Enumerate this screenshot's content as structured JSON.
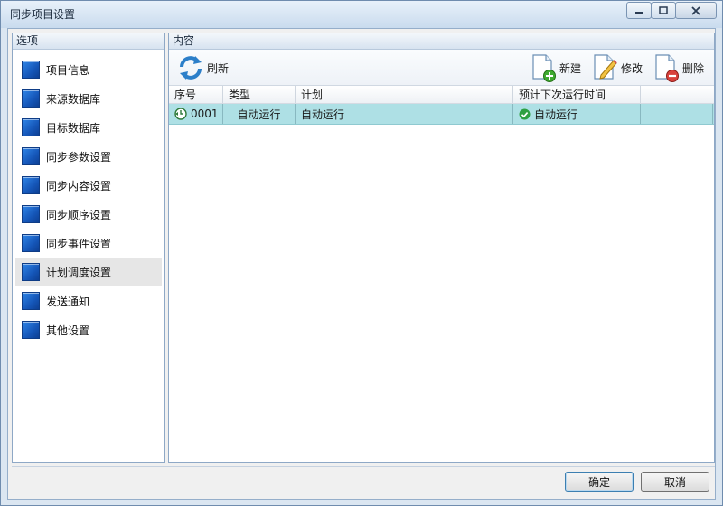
{
  "window": {
    "title": "同步项目设置",
    "controls": {
      "minimize": "▭",
      "restore": "▢",
      "close": "✕"
    }
  },
  "left_panel": {
    "header": "选项",
    "items": [
      {
        "label": "项目信息"
      },
      {
        "label": "来源数据库"
      },
      {
        "label": "目标数据库"
      },
      {
        "label": "同步参数设置"
      },
      {
        "label": "同步内容设置"
      },
      {
        "label": "同步顺序设置"
      },
      {
        "label": "同步事件设置"
      },
      {
        "label": "计划调度设置",
        "active": true
      },
      {
        "label": "发送通知"
      },
      {
        "label": "其他设置"
      }
    ]
  },
  "right_panel": {
    "header": "内容",
    "toolbar": {
      "refresh": "刷新",
      "new": "新建",
      "edit": "修改",
      "delete": "删除"
    },
    "table": {
      "columns": [
        "序号",
        "类型",
        "计划",
        "预计下次运行时间",
        ""
      ],
      "rows": [
        {
          "id": "0001",
          "type": "自动运行",
          "plan": "自动运行",
          "next_run": "自动运行",
          "extra": ""
        }
      ]
    }
  },
  "footer": {
    "ok": "确定",
    "cancel": "取消"
  },
  "colors": {
    "selected_row": "#aee0e5",
    "nav_icon": "#1f66c8",
    "active_nav": "#e6e6e6"
  }
}
